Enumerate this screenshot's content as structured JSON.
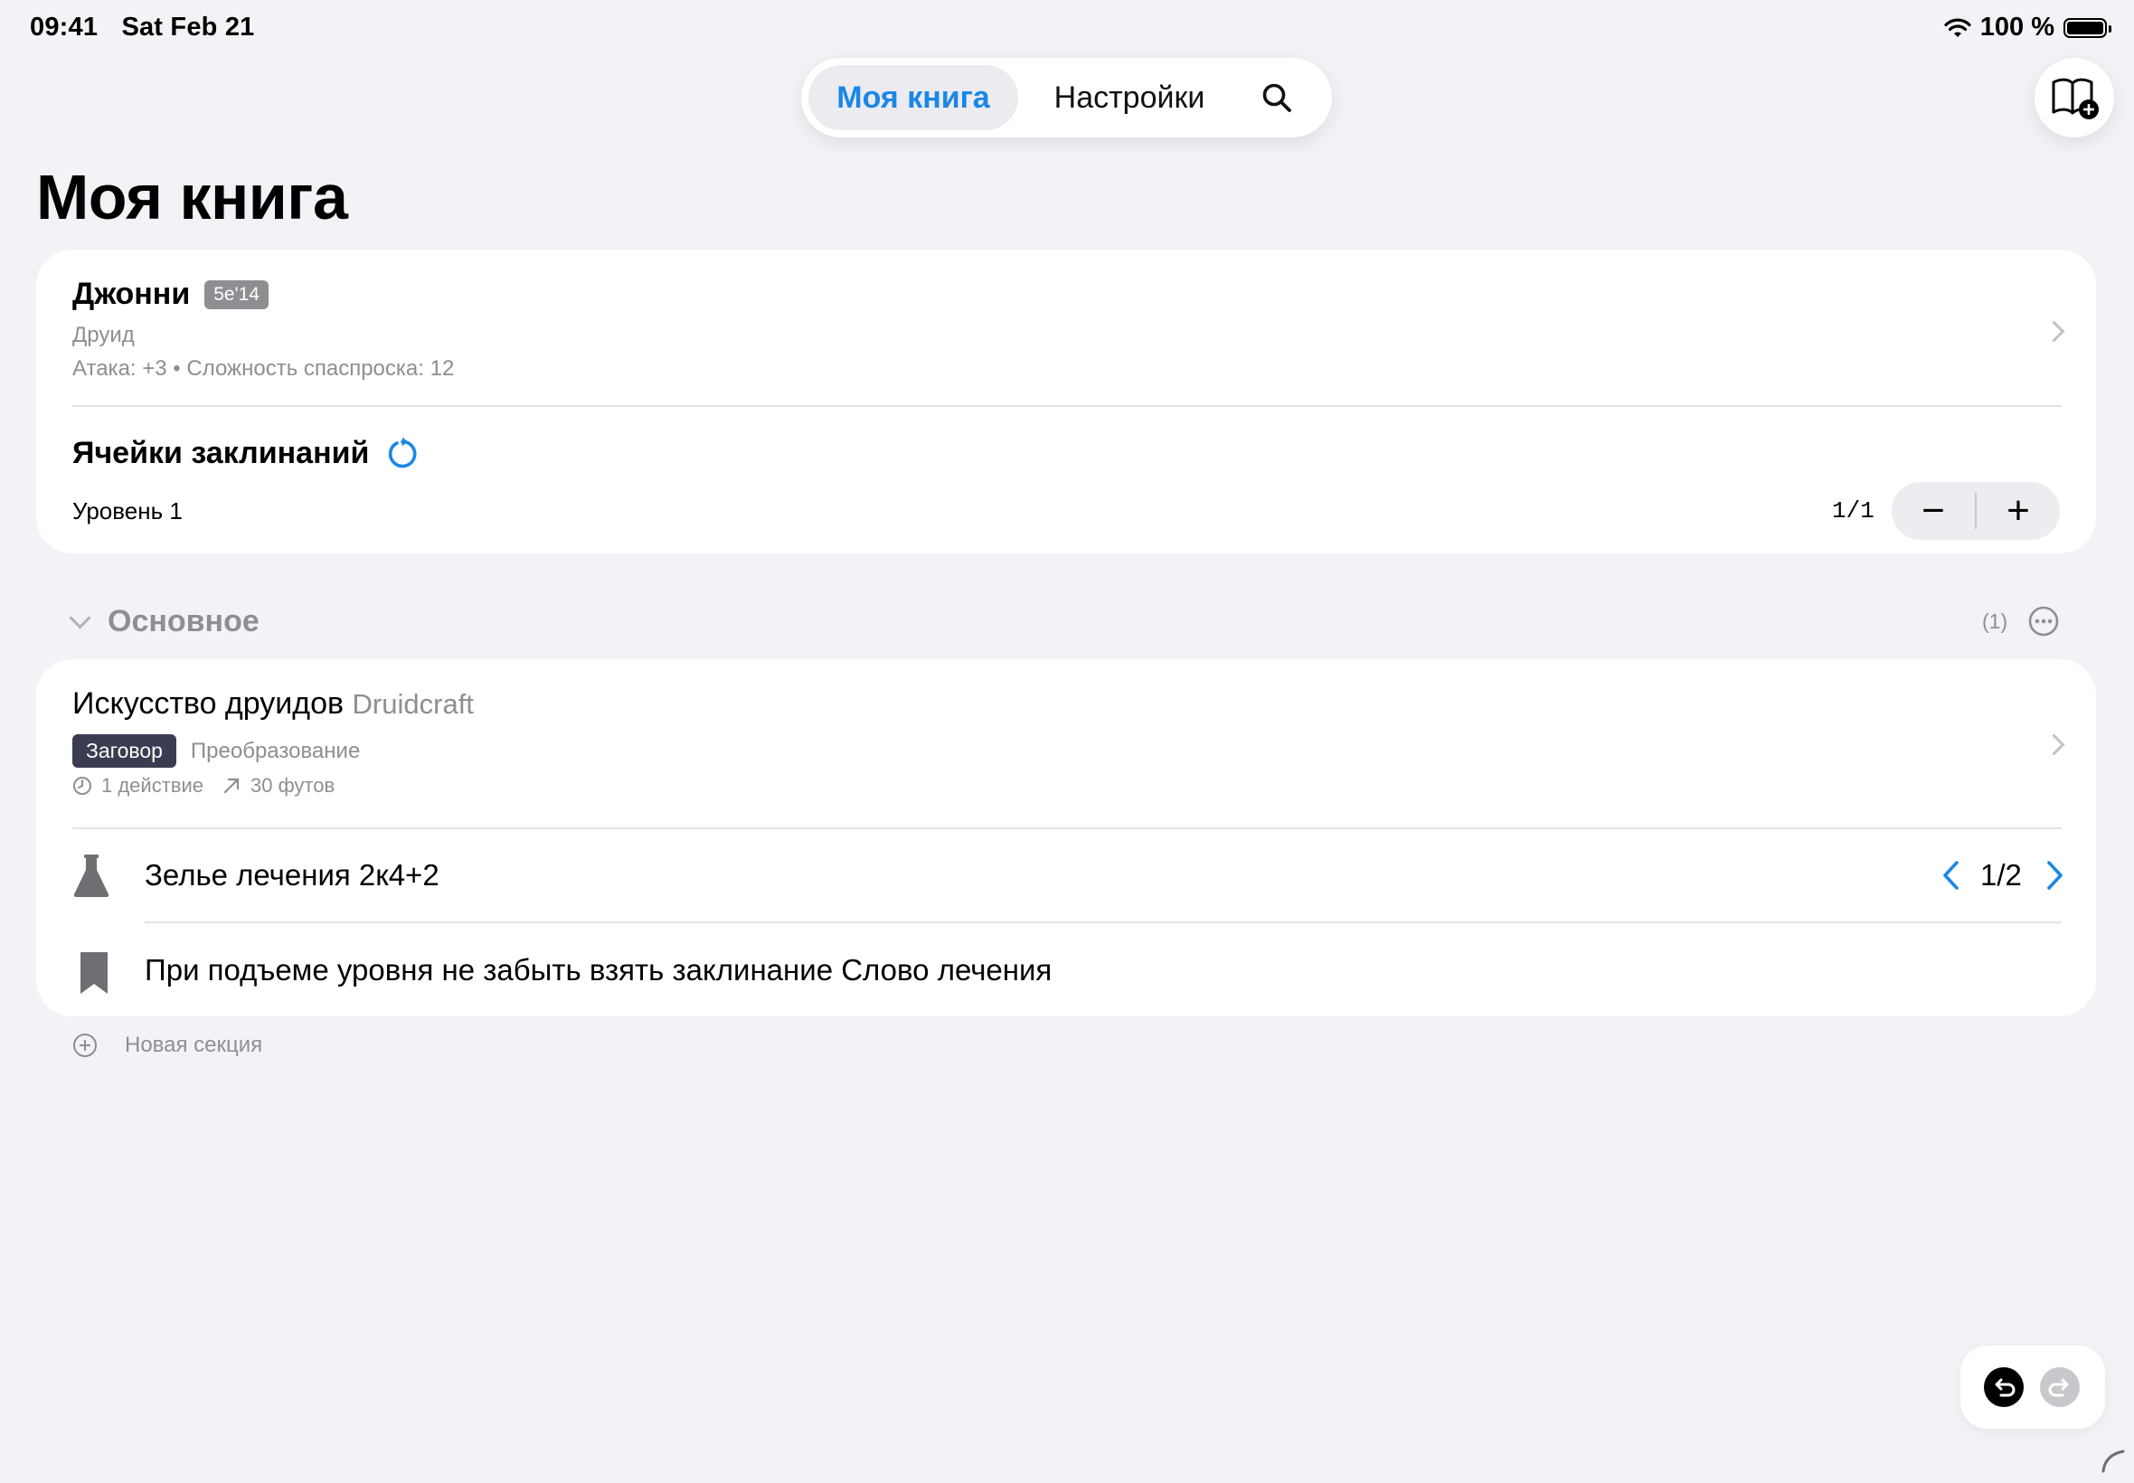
{
  "status_bar": {
    "time": "09:41",
    "date": "Sat Feb 21",
    "battery": "100 %"
  },
  "nav": {
    "tab_my_book": "Моя книга",
    "tab_settings": "Настройки"
  },
  "page_title": "Моя книга",
  "character": {
    "name": "Джонни",
    "badge": "5e'14",
    "class": "Друид",
    "stats": "Атака: +3 • Сложность спаспроска: 12"
  },
  "spell_slots": {
    "title": "Ячейки заклинаний",
    "level_label": "Уровень 1",
    "count": "1/1",
    "minus": "−",
    "plus": "+"
  },
  "section": {
    "title": "Основное",
    "count": "(1)"
  },
  "spell": {
    "name": "Искусство друидов",
    "name_en": "Druidcraft",
    "tag": "Заговор",
    "school": "Преобразование",
    "casting_time": "1 действие",
    "range": "30 футов"
  },
  "potion": {
    "label": "Зелье лечения 2к4+2",
    "pager": "1/2"
  },
  "note": {
    "text": "При подъеме уровня не забыть взять заклинание Слово лечения"
  },
  "new_section": {
    "label": "Новая секция"
  },
  "colors": {
    "accent": "#1a87e6",
    "tag_dark": "#3a3d52",
    "background": "#f2f2f7",
    "secondary_text": "#8e8e93"
  }
}
